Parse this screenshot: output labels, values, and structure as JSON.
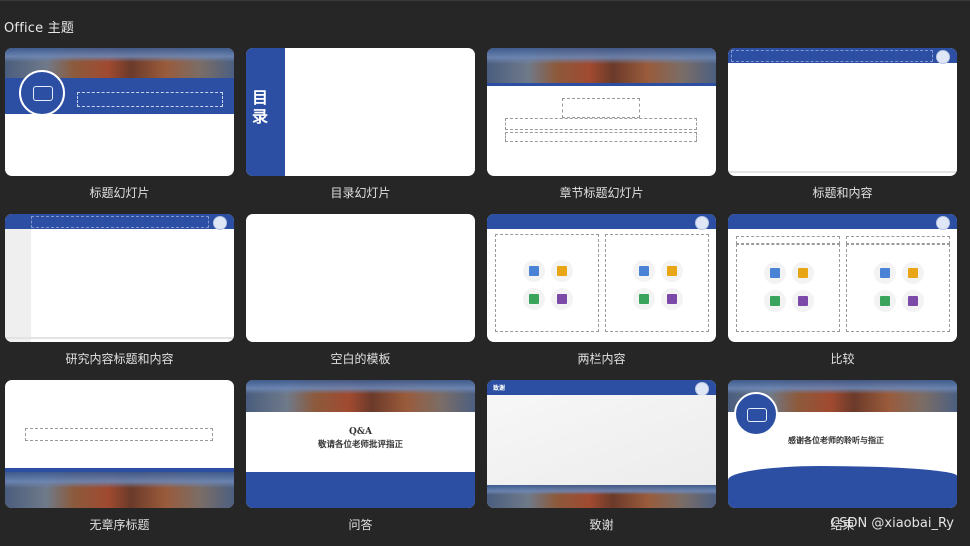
{
  "section_title": "Office 主题",
  "layouts": [
    {
      "label": "标题幻灯片"
    },
    {
      "label": "目录幻灯片",
      "thumb_text": "目录"
    },
    {
      "label": "章节标题幻灯片"
    },
    {
      "label": "标题和内容"
    },
    {
      "label": "研究内容标题和内容"
    },
    {
      "label": "空白的模板"
    },
    {
      "label": "两栏内容"
    },
    {
      "label": "比较"
    },
    {
      "label": "无章序标题"
    },
    {
      "label": "问答",
      "thumb_line1": "Q&A",
      "thumb_line2": "敬请各位老师批评指正"
    },
    {
      "label": "致谢",
      "thumb_tag": "致谢"
    },
    {
      "label": "结束",
      "thumb_text": "感谢各位老师的聆听与指正"
    }
  ],
  "watermark": "CSDN @xiaobai_Ry",
  "colors": {
    "accent_blue": "#2c4fa3",
    "panel_bg": "#262626"
  }
}
